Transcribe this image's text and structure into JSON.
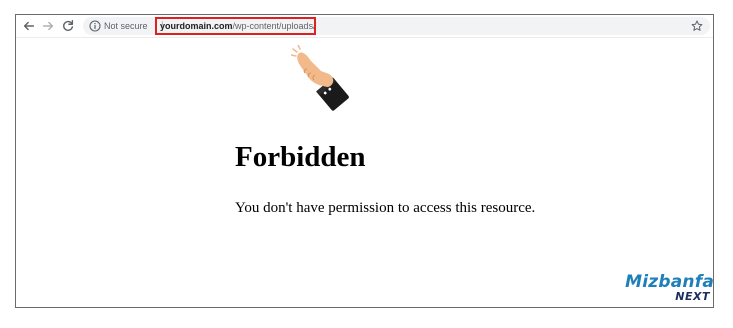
{
  "browser": {
    "nav": {
      "back_icon": "arrow-left-icon",
      "forward_icon": "arrow-right-icon",
      "reload_icon": "reload-icon"
    },
    "omnibox": {
      "security_icon": "info-icon",
      "security_label": "Not secure",
      "url_domain": "yourdomain.com",
      "url_path": "/wp-content/uploads/",
      "highlight_color": "#e02020"
    },
    "bookmark_icon": "star-icon"
  },
  "annotation": {
    "pointer_icon": "pointing-hand-icon"
  },
  "page": {
    "heading": "Forbidden",
    "message": "You don't have permission to access this resource."
  },
  "brand": {
    "name": "Mizbanfa",
    "sub": "NEXT",
    "colors": {
      "primary": "#1f7fb8",
      "secondary": "#1c2f5c"
    }
  }
}
